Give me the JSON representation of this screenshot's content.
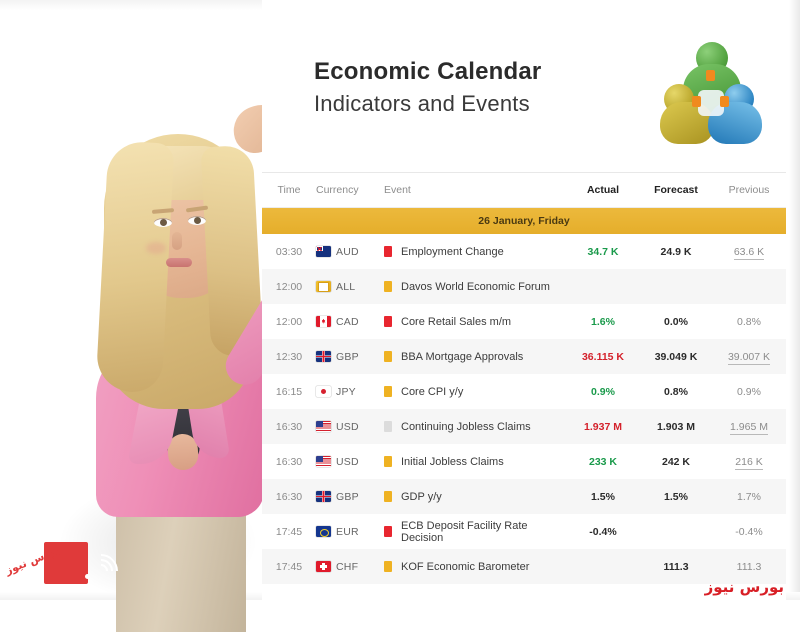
{
  "header": {
    "title_main": "Economic Calendar",
    "title_sub": "Indicators and Events",
    "logo_name": "metatrader-logo"
  },
  "table": {
    "columns": {
      "time": "Time",
      "currency": "Currency",
      "event": "Event",
      "actual": "Actual",
      "forecast": "Forecast",
      "previous": "Previous"
    },
    "date_band": "26 January, Friday",
    "rows": [
      {
        "time": "03:30",
        "currency": "AUD",
        "flag": "flag-australia",
        "impact": "high",
        "event": "Employment Change",
        "actual": "34.7 K",
        "actual_tone": "pos",
        "forecast": "24.9 K",
        "previous": "63.6 K",
        "previous_revised": true
      },
      {
        "time": "12:00",
        "currency": "ALL",
        "flag": "flag-all",
        "impact": "med",
        "event": "Davos World Economic Forum",
        "actual": "",
        "actual_tone": "neu",
        "forecast": "",
        "previous": "",
        "previous_revised": false
      },
      {
        "time": "12:00",
        "currency": "CAD",
        "flag": "flag-canada",
        "impact": "high",
        "event": "Core Retail Sales m/m",
        "actual": "1.6%",
        "actual_tone": "pos",
        "forecast": "0.0%",
        "previous": "0.8%",
        "previous_revised": false
      },
      {
        "time": "12:30",
        "currency": "GBP",
        "flag": "flag-uk",
        "impact": "med",
        "event": "BBA Mortgage Approvals",
        "actual": "36.115 K",
        "actual_tone": "neg",
        "forecast": "39.049 K",
        "previous": "39.007 K",
        "previous_revised": true
      },
      {
        "time": "16:15",
        "currency": "JPY",
        "flag": "flag-japan",
        "impact": "med",
        "event": "Core CPI y/y",
        "actual": "0.9%",
        "actual_tone": "pos",
        "forecast": "0.8%",
        "previous": "0.9%",
        "previous_revised": false
      },
      {
        "time": "16:30",
        "currency": "USD",
        "flag": "flag-usa",
        "impact": "low",
        "event": "Continuing Jobless Claims",
        "actual": "1.937 M",
        "actual_tone": "neg",
        "forecast": "1.903 M",
        "previous": "1.965 M",
        "previous_revised": true
      },
      {
        "time": "16:30",
        "currency": "USD",
        "flag": "flag-usa",
        "impact": "med",
        "event": "Initial Jobless Claims",
        "actual": "233 K",
        "actual_tone": "pos",
        "forecast": "242 K",
        "previous": "216 K",
        "previous_revised": true
      },
      {
        "time": "16:30",
        "currency": "GBP",
        "flag": "flag-uk",
        "impact": "med",
        "event": "GDP y/y",
        "actual": "1.5%",
        "actual_tone": "neu",
        "forecast": "1.5%",
        "previous": "1.7%",
        "previous_revised": false
      },
      {
        "time": "17:45",
        "currency": "EUR",
        "flag": "flag-eu",
        "impact": "high",
        "event": "ECB Deposit Facility Rate Decision",
        "actual": "-0.4%",
        "actual_tone": "neu",
        "forecast": "",
        "previous": "-0.4%",
        "previous_revised": false
      },
      {
        "time": "17:45",
        "currency": "CHF",
        "flag": "flag-switzerland",
        "impact": "med",
        "event": "KOF Economic Barometer",
        "actual": "",
        "actual_tone": "neu",
        "forecast": "111.3",
        "previous": "111.3",
        "previous_revised": false
      }
    ]
  },
  "watermarks": {
    "left_text": "بورس نیوز",
    "right_text": "بورس نیوز"
  },
  "colors": {
    "date_band": "#e5ae2b",
    "impact_high": "#e8262f",
    "impact_med": "#efb222",
    "impact_low": "#dcdcdc",
    "positive": "#1a9a4b",
    "negative": "#d4212b",
    "watermark": "#d81f26"
  }
}
